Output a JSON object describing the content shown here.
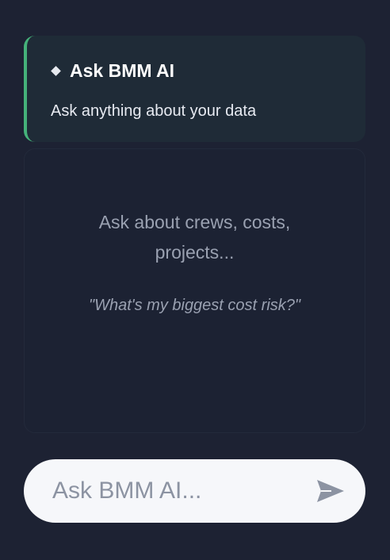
{
  "header": {
    "title": "Ask BMM AI",
    "subtitle": "Ask anything about your data",
    "icon": "diamond-icon",
    "accent_color": "#45b27a"
  },
  "chat": {
    "empty_prompt": "Ask about crews, costs, projects...",
    "example_question": "\"What's my biggest cost risk?\""
  },
  "input": {
    "placeholder": "Ask BMM AI...",
    "value": "",
    "send_icon": "send-icon"
  }
}
